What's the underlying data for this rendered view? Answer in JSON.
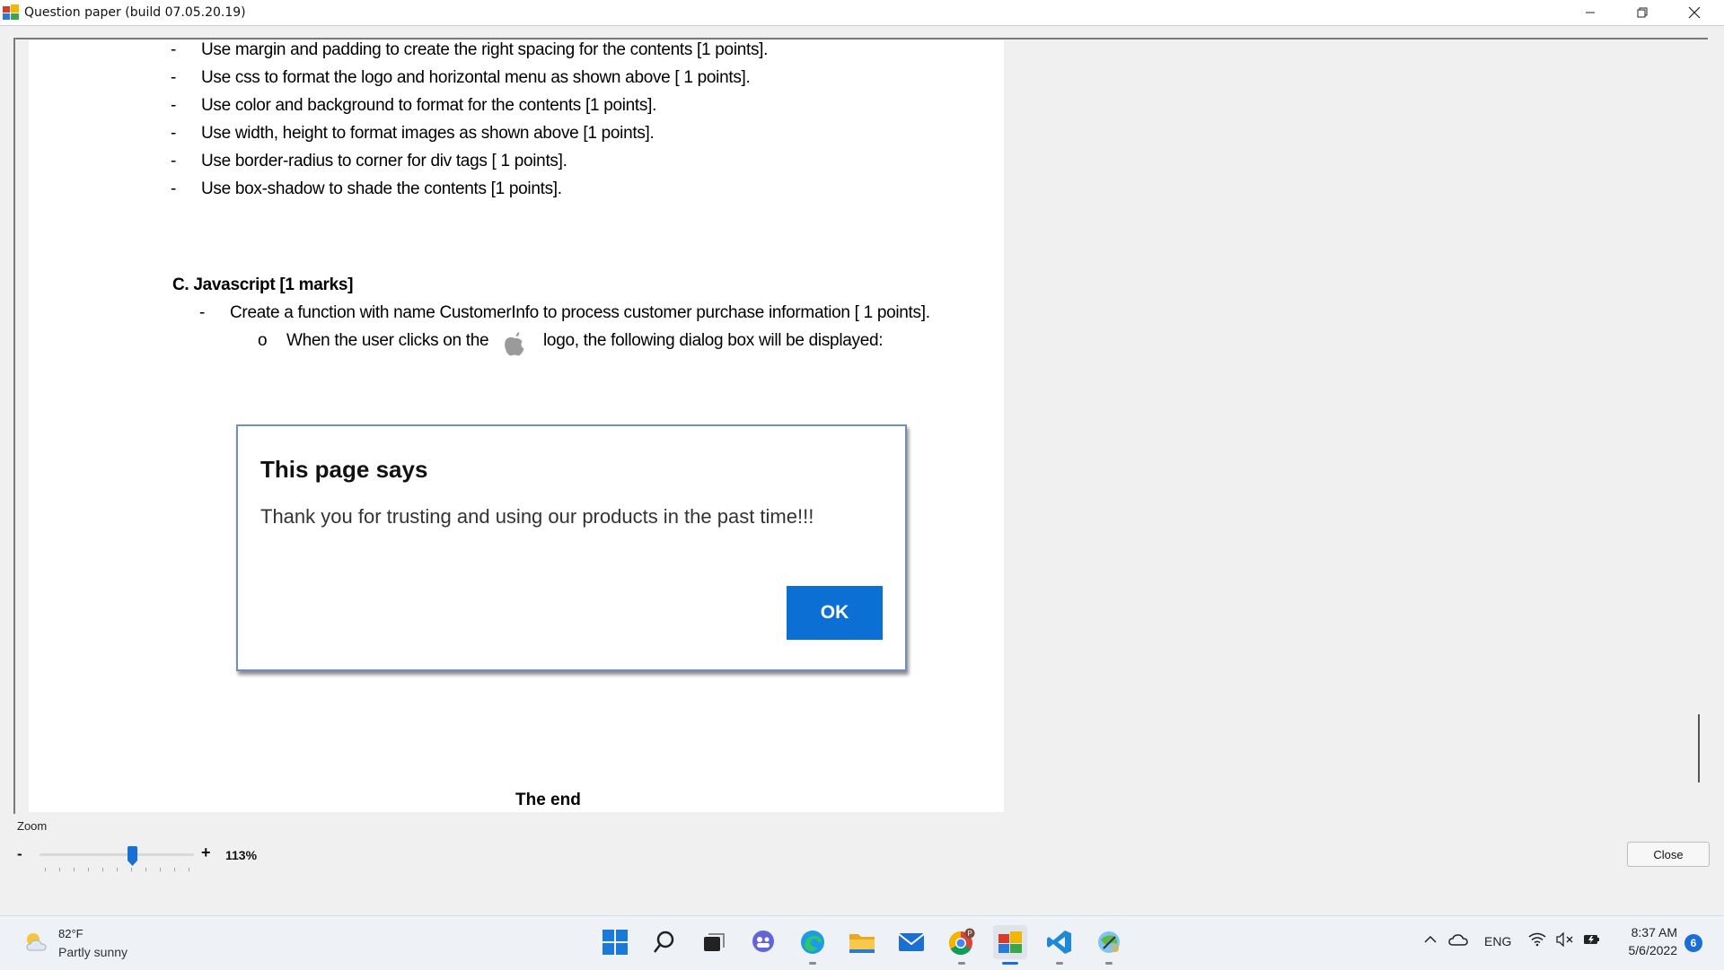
{
  "window": {
    "title": "Question paper (build 07.05.20.19)",
    "controls": {
      "minimize_icon": "minimize-icon",
      "restore_icon": "restore-icon",
      "close_icon": "close-icon"
    }
  },
  "document": {
    "bullets": [
      {
        "dash": "-",
        "text": "Use margin and padding to create the right spacing for the contents [1 points]."
      },
      {
        "dash": "-",
        "text": "Use css to format the logo and horizontal menu as shown above [ 1 points]."
      },
      {
        "dash": "-",
        "text": "Use color and background  to format for the contents [1 points]."
      },
      {
        "dash": "-",
        "text": "Use width, height to format images as shown above [1 points]."
      },
      {
        "dash": "-",
        "text": "Use border-radius to corner for div tags [ 1 points]."
      },
      {
        "dash": "-",
        "text": "Use box-shadow to shade the contents [1 points]."
      }
    ],
    "section_c": {
      "heading": "C.  Javascript [1 marks]",
      "bullet": {
        "dash": "-",
        "text": "Create a function with name CustomerInfo to process customer purchase information [ 1 points]."
      },
      "sub_bullet": {
        "marker": "o",
        "text_before": "When the user clicks on the",
        "text_after": "logo, the following dialog box will be displayed:",
        "icon": "apple-logo-icon"
      }
    },
    "dialog_image": {
      "title": "This page says",
      "message": "Thank you for trusting and using our products in the past time!!!",
      "ok_label": "OK"
    },
    "the_end": "The end"
  },
  "zoom": {
    "label": "Zoom",
    "minus": "-",
    "plus": "+",
    "value": "113%",
    "slider_fraction": 0.6
  },
  "close_button": "Close",
  "taskbar": {
    "weather": {
      "temp": "82°F",
      "condition": "Partly sunny",
      "icon": "partly-sunny-icon"
    },
    "apps": [
      "start-icon",
      "search-icon",
      "task-view-icon",
      "chat-icon",
      "edge-icon",
      "file-explorer-icon",
      "mail-icon",
      "chrome-icon",
      "question-paper-app-icon",
      "vscode-icon",
      "snipping-tool-icon"
    ],
    "tray": {
      "language": "ENG",
      "time": "8:37 AM",
      "date": "5/6/2022",
      "notification_count": "6"
    },
    "accent_color": "#1a6fd6"
  }
}
